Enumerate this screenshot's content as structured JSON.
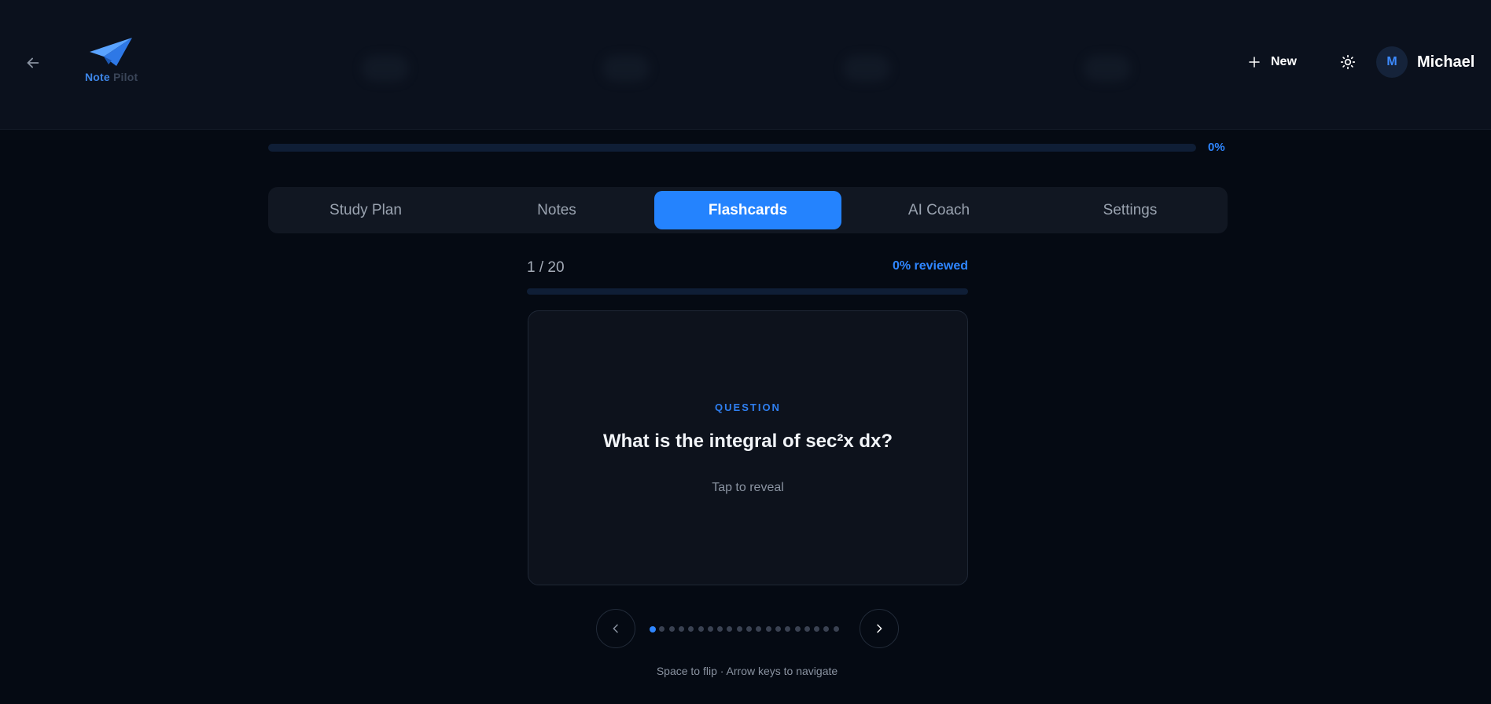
{
  "header": {
    "logo": {
      "word1": "Note",
      "word2": "Pilot"
    },
    "new_label": "New",
    "user": {
      "initial": "M",
      "name": "Michael"
    }
  },
  "progress": {
    "value": 0,
    "label": "0%"
  },
  "tabs": [
    {
      "label": "Study Plan",
      "active": false
    },
    {
      "label": "Notes",
      "active": false
    },
    {
      "label": "Flashcards",
      "active": true
    },
    {
      "label": "AI Coach",
      "active": false
    },
    {
      "label": "Settings",
      "active": false
    }
  ],
  "flashcards": {
    "counter": "1 / 20",
    "reviewed_label": "0% reviewed",
    "reviewed_value": 0,
    "current_index": 1,
    "total": 20,
    "card": {
      "label": "QUESTION",
      "question": "What is the integral of sec²x dx?",
      "hint": "Tap to reveal"
    },
    "shortcuts": "Space to flip · Arrow keys to navigate"
  },
  "icons": {
    "back": "arrow-left-icon",
    "new": "plus-icon",
    "theme": "sun-icon",
    "prev": "chevron-left-icon",
    "next": "chevron-right-icon",
    "logo": "paper-plane-icon"
  },
  "colors": {
    "accent": "#2483fe",
    "background": "#050a13",
    "header": "#0b111d",
    "card": "#0d121c"
  }
}
